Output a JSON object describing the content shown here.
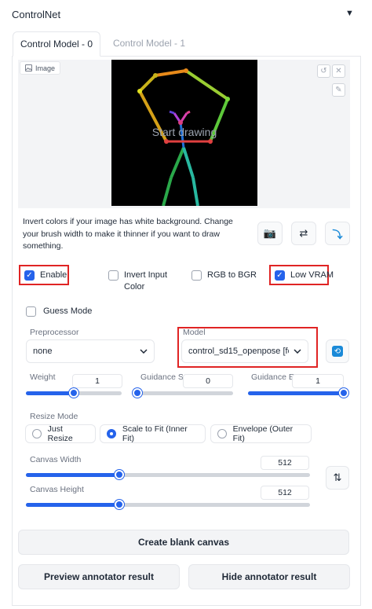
{
  "header": {
    "title": "ControlNet",
    "collapse_glyph": "▼"
  },
  "tabs": [
    {
      "label": "Control Model - 0",
      "active": true
    },
    {
      "label": "Control Model - 1",
      "active": false
    }
  ],
  "image": {
    "label": "Image",
    "label_icon": "image-icon",
    "placeholder": "Start drawing",
    "tools": {
      "undo": "↺",
      "clear": "✕",
      "brush": "✎"
    }
  },
  "hint_text": "Invert colors if your image has white background. Change your brush width to make it thinner if you want to draw something.",
  "action_buttons": {
    "camera": "📷",
    "swap": "⇄",
    "send": "⤵"
  },
  "checkboxes": [
    {
      "label": "Enable",
      "checked": true
    },
    {
      "label": "Invert Input Color",
      "checked": false
    },
    {
      "label": "RGB to BGR",
      "checked": false
    },
    {
      "label": "Low VRAM",
      "checked": true
    },
    {
      "label": "Guess Mode",
      "checked": false
    }
  ],
  "preprocessor": {
    "label": "Preprocessor",
    "value": "none"
  },
  "model": {
    "label": "Model",
    "value": "control_sd15_openpose [fe"
  },
  "refresh_glyph": "⟲",
  "sliders": {
    "weight": {
      "label": "Weight",
      "value": "1",
      "fraction": 0.5
    },
    "guidance_start": {
      "label": "Guidance Sta",
      "value": "0",
      "fraction": 0.0
    },
    "guidance_end": {
      "label": "Guidance En",
      "value": "1",
      "fraction": 1.0
    }
  },
  "resize_mode": {
    "label": "Resize Mode",
    "options": [
      "Just Resize",
      "Scale to Fit (Inner Fit)",
      "Envelope (Outer Fit)"
    ],
    "selected": "Scale to Fit (Inner Fit)"
  },
  "canvas_width": {
    "label": "Canvas Width",
    "value": "512",
    "fraction": 0.33
  },
  "canvas_height": {
    "label": "Canvas Height",
    "value": "512",
    "fraction": 0.33
  },
  "swap_dims_glyph": "⇅",
  "buttons": {
    "create_blank": "Create blank canvas",
    "preview": "Preview annotator result",
    "hide": "Hide annotator result"
  },
  "accent_color": "#2563eb",
  "highlight_color": "#e02424"
}
